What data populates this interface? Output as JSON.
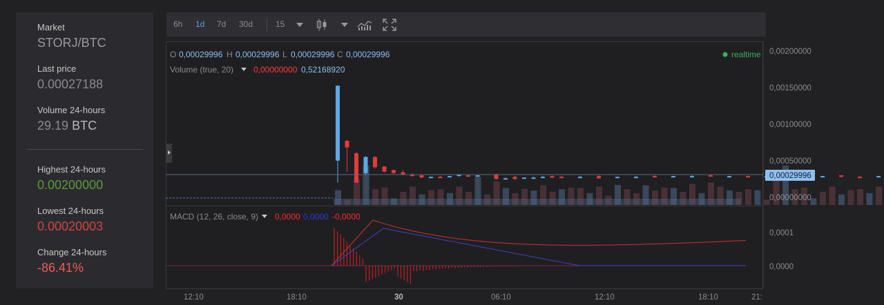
{
  "market": {
    "label": "Market",
    "pair": "STORJ/BTC",
    "last_price_label": "Last price",
    "last_price": "0.00027188",
    "volume_label": "Volume 24-hours",
    "volume_value": "29.19",
    "volume_unit": "BTC",
    "highest_label": "Highest 24-hours",
    "highest": "0.00200000",
    "lowest_label": "Lowest 24-hours",
    "lowest": "0.00020003",
    "change_label": "Change 24-hours",
    "change": "-86.41%"
  },
  "toolbar": {
    "ranges": [
      "6h",
      "1d",
      "7d",
      "30d"
    ],
    "active_range": "1d",
    "interval": "15"
  },
  "legend": {
    "o_label": "O",
    "o": "0,00029996",
    "h_label": "H",
    "h": "0,00029996",
    "l_label": "L",
    "l": "0,00029996",
    "c_label": "C",
    "c": "0,00029996",
    "realtime": "realtime",
    "volume_label": "Volume (true, 20)",
    "volume_v1": "0,00000000",
    "volume_v2": "0,52168920",
    "macd_label": "MACD (12, 26, close, 9)",
    "macd_v1": "0,0000",
    "macd_v2": "0,0000",
    "macd_v3": "-0,0000"
  },
  "price_axis": [
    "0,00200000",
    "0,00150000",
    "0,00100000",
    "0,00050000",
    "0,00000000"
  ],
  "current_price": "0,00029996",
  "macd_axis": [
    "0,0001",
    "0,0000"
  ],
  "time_axis": [
    "12:10",
    "18:10",
    "30",
    "06:10",
    "12:10",
    "18:10",
    "21:"
  ],
  "colors": {
    "up": "#5ea8e6",
    "down": "#e23b3b",
    "realtime": "#3fae5a",
    "accent": "#5f9be5"
  },
  "chart_data": {
    "type": "candlestick",
    "price_ylim": [
      0,
      0.002
    ],
    "candles": [
      {
        "i": 0,
        "o": 0.0005,
        "h": 0.00152,
        "l": 0.0002,
        "c": 0.00152
      },
      {
        "i": 1,
        "o": 0.00077,
        "h": 0.00078,
        "l": 0.00035,
        "c": 0.00068
      },
      {
        "i": 2,
        "o": 0.0006,
        "h": 0.00062,
        "l": 0.0002,
        "c": 0.0002
      },
      {
        "i": 3,
        "o": 0.00033,
        "h": 0.00056,
        "l": 0.0003,
        "c": 0.00055
      },
      {
        "i": 4,
        "o": 0.00055,
        "h": 0.00056,
        "l": 0.00039,
        "c": 0.00041
      },
      {
        "i": 5,
        "o": 0.00042,
        "h": 0.00042,
        "l": 0.00034,
        "c": 0.00035
      },
      {
        "i": 6,
        "o": 0.00037,
        "h": 0.00038,
        "l": 0.00032,
        "c": 0.00033
      },
      {
        "i": 7,
        "o": 0.00034,
        "h": 0.00037,
        "l": 0.0003,
        "c": 0.00031
      },
      {
        "i": 8,
        "o": 0.00031,
        "h": 0.00033,
        "l": 0.00028,
        "c": 0.00029
      },
      {
        "i": 9,
        "o": 0.0003,
        "h": 0.00031,
        "l": 0.00026,
        "c": 0.00027
      },
      {
        "i": 10,
        "o": 0.00027,
        "h": 0.00028,
        "l": 0.00026,
        "c": 0.00028
      },
      {
        "i": 11,
        "o": 0.00028,
        "h": 0.00029,
        "l": 0.00027,
        "c": 0.00027
      },
      {
        "i": 12,
        "o": 0.00028,
        "h": 0.00029,
        "l": 0.00027,
        "c": 0.00029
      },
      {
        "i": 13,
        "o": 0.00029,
        "h": 0.00031,
        "l": 0.00028,
        "c": 0.00031
      },
      {
        "i": 14,
        "o": 0.0003,
        "h": 0.00031,
        "l": 0.00029,
        "c": 0.00029
      },
      {
        "i": 15,
        "o": 0.00029,
        "h": 0.0003,
        "l": 0.00028,
        "c": 0.0003
      },
      {
        "i": 17,
        "o": 0.00031,
        "h": 0.00032,
        "l": 0.00024,
        "c": 0.00025
      },
      {
        "i": 18,
        "o": 0.00025,
        "h": 0.00027,
        "l": 0.00024,
        "c": 0.00026
      },
      {
        "i": 19,
        "o": 0.00028,
        "h": 0.00029,
        "l": 0.00024,
        "c": 0.00025
      },
      {
        "i": 20,
        "o": 0.00026,
        "h": 0.00027,
        "l": 0.00026,
        "c": 0.00027
      },
      {
        "i": 21,
        "o": 0.00027,
        "h": 0.00028,
        "l": 0.00027,
        "c": 0.00027
      },
      {
        "i": 22,
        "o": 0.00027,
        "h": 0.00029,
        "l": 0.00027,
        "c": 0.00028
      },
      {
        "i": 23,
        "o": 0.00029,
        "h": 0.0003,
        "l": 0.00026,
        "c": 0.00027
      },
      {
        "i": 24,
        "o": 0.00028,
        "h": 0.00029,
        "l": 0.00027,
        "c": 0.00027
      },
      {
        "i": 26,
        "o": 0.00028,
        "h": 0.00029,
        "l": 0.00027,
        "c": 0.00028
      },
      {
        "i": 28,
        "o": 0.00029,
        "h": 0.0003,
        "l": 0.00025,
        "c": 0.00026
      },
      {
        "i": 30,
        "o": 0.00027,
        "h": 0.00028,
        "l": 0.00026,
        "c": 0.00028
      },
      {
        "i": 32,
        "o": 0.00028,
        "h": 0.00029,
        "l": 0.00027,
        "c": 0.00028
      },
      {
        "i": 34,
        "o": 0.00029,
        "h": 0.0003,
        "l": 0.00027,
        "c": 0.00028
      },
      {
        "i": 36,
        "o": 0.00028,
        "h": 0.00029,
        "l": 0.00027,
        "c": 0.00029
      },
      {
        "i": 38,
        "o": 0.00029,
        "h": 0.0003,
        "l": 0.00028,
        "c": 0.00029
      },
      {
        "i": 40,
        "o": 0.0003,
        "h": 0.00031,
        "l": 0.00028,
        "c": 0.00029
      },
      {
        "i": 42,
        "o": 0.00028,
        "h": 0.00029,
        "l": 0.00027,
        "c": 0.00029
      },
      {
        "i": 44,
        "o": 0.00029,
        "h": 0.0003,
        "l": 0.00028,
        "c": 0.00028
      },
      {
        "i": 46,
        "o": 0.00028,
        "h": 0.00029,
        "l": 0.00027,
        "c": 0.00029
      },
      {
        "i": 48,
        "o": 0.00029,
        "h": 0.0003,
        "l": 0.00028,
        "c": 0.0003
      },
      {
        "i": 50,
        "o": 0.0003,
        "h": 0.00031,
        "l": 0.00028,
        "c": 0.00028
      },
      {
        "i": 52,
        "o": 0.00028,
        "h": 0.00029,
        "l": 0.00027,
        "c": 0.00029
      },
      {
        "i": 54,
        "o": 0.0003,
        "h": 0.0003,
        "l": 0.00027,
        "c": 0.00028
      },
      {
        "i": 56,
        "o": 0.00028,
        "h": 0.00029,
        "l": 0.00027,
        "c": 0.00027
      },
      {
        "i": 58,
        "o": 0.00028,
        "h": 0.00029,
        "l": 0.00027,
        "c": 0.00029
      },
      {
        "i": 60,
        "o": 0.00029,
        "h": 0.00031,
        "l": 0.00028,
        "c": 0.0003
      }
    ]
  }
}
